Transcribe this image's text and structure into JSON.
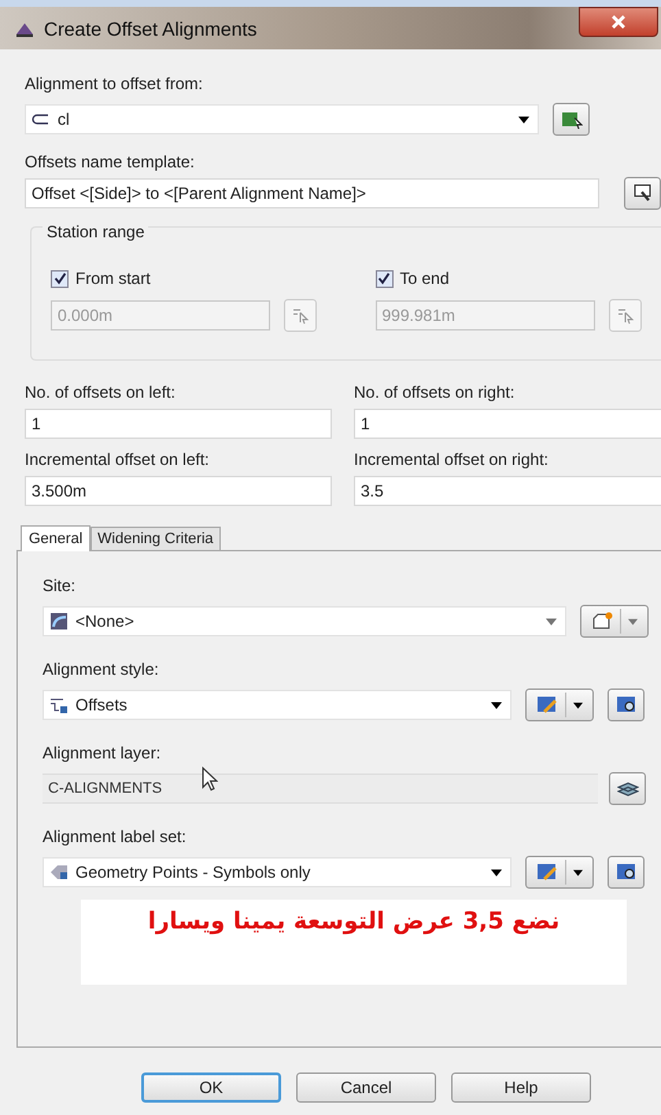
{
  "window": {
    "title": "Create Offset Alignments"
  },
  "alignment_from": {
    "label": "Alignment to offset from:",
    "value": "cl"
  },
  "name_template": {
    "label": "Offsets name template:",
    "value": "Offset <[Side]> to <[Parent Alignment Name]>"
  },
  "station_range": {
    "title": "Station range",
    "ends": [
      {
        "label": "From start",
        "checked": true,
        "value": "0.000m",
        "disabled": true
      },
      {
        "label": "To end",
        "checked": true,
        "value": "999.981m",
        "disabled": true
      }
    ]
  },
  "offsets": [
    {
      "label": "No. of offsets on left:",
      "value": "1"
    },
    {
      "label": "No. of offsets on right:",
      "value": "1"
    },
    {
      "label": "Incremental offset on left:",
      "value": "3.500m"
    },
    {
      "label": "Incremental offset on right:",
      "value": "3.5"
    }
  ],
  "tabs": [
    {
      "label": "General",
      "selected": true
    },
    {
      "label": "Widening Criteria",
      "selected": false
    }
  ],
  "general": [
    {
      "kind": "site",
      "label": "Site:",
      "value": "<None>",
      "disabled": false
    },
    {
      "kind": "style",
      "label": "Alignment style:",
      "value": "Offsets",
      "disabled": false
    },
    {
      "kind": "layer",
      "label": "Alignment layer:",
      "value": "C-ALIGNMENTS",
      "disabled": true
    },
    {
      "kind": "label_set",
      "label": "Alignment label set:",
      "value": "Geometry Points - Symbols only",
      "disabled": false
    }
  ],
  "note": "نضع 3,5 عرض التوسعة يمينا ويسارا",
  "buttons": [
    {
      "label": "OK",
      "default": true
    },
    {
      "label": "Cancel",
      "default": false
    },
    {
      "label": "Help",
      "default": false
    }
  ]
}
